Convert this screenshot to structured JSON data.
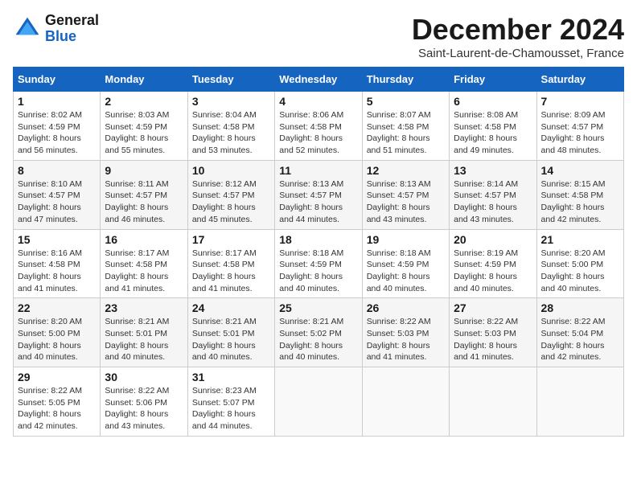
{
  "header": {
    "logo_line1": "General",
    "logo_line2": "Blue",
    "title": "December 2024",
    "subtitle": "Saint-Laurent-de-Chamousset, France"
  },
  "weekdays": [
    "Sunday",
    "Monday",
    "Tuesday",
    "Wednesday",
    "Thursday",
    "Friday",
    "Saturday"
  ],
  "weeks": [
    [
      {
        "day": "1",
        "sunrise": "8:02 AM",
        "sunset": "4:59 PM",
        "daylight": "8 hours and 56 minutes."
      },
      {
        "day": "2",
        "sunrise": "8:03 AM",
        "sunset": "4:59 PM",
        "daylight": "8 hours and 55 minutes."
      },
      {
        "day": "3",
        "sunrise": "8:04 AM",
        "sunset": "4:58 PM",
        "daylight": "8 hours and 53 minutes."
      },
      {
        "day": "4",
        "sunrise": "8:06 AM",
        "sunset": "4:58 PM",
        "daylight": "8 hours and 52 minutes."
      },
      {
        "day": "5",
        "sunrise": "8:07 AM",
        "sunset": "4:58 PM",
        "daylight": "8 hours and 51 minutes."
      },
      {
        "day": "6",
        "sunrise": "8:08 AM",
        "sunset": "4:58 PM",
        "daylight": "8 hours and 49 minutes."
      },
      {
        "day": "7",
        "sunrise": "8:09 AM",
        "sunset": "4:57 PM",
        "daylight": "8 hours and 48 minutes."
      }
    ],
    [
      {
        "day": "8",
        "sunrise": "8:10 AM",
        "sunset": "4:57 PM",
        "daylight": "8 hours and 47 minutes."
      },
      {
        "day": "9",
        "sunrise": "8:11 AM",
        "sunset": "4:57 PM",
        "daylight": "8 hours and 46 minutes."
      },
      {
        "day": "10",
        "sunrise": "8:12 AM",
        "sunset": "4:57 PM",
        "daylight": "8 hours and 45 minutes."
      },
      {
        "day": "11",
        "sunrise": "8:13 AM",
        "sunset": "4:57 PM",
        "daylight": "8 hours and 44 minutes."
      },
      {
        "day": "12",
        "sunrise": "8:13 AM",
        "sunset": "4:57 PM",
        "daylight": "8 hours and 43 minutes."
      },
      {
        "day": "13",
        "sunrise": "8:14 AM",
        "sunset": "4:57 PM",
        "daylight": "8 hours and 43 minutes."
      },
      {
        "day": "14",
        "sunrise": "8:15 AM",
        "sunset": "4:58 PM",
        "daylight": "8 hours and 42 minutes."
      }
    ],
    [
      {
        "day": "15",
        "sunrise": "8:16 AM",
        "sunset": "4:58 PM",
        "daylight": "8 hours and 41 minutes."
      },
      {
        "day": "16",
        "sunrise": "8:17 AM",
        "sunset": "4:58 PM",
        "daylight": "8 hours and 41 minutes."
      },
      {
        "day": "17",
        "sunrise": "8:17 AM",
        "sunset": "4:58 PM",
        "daylight": "8 hours and 41 minutes."
      },
      {
        "day": "18",
        "sunrise": "8:18 AM",
        "sunset": "4:59 PM",
        "daylight": "8 hours and 40 minutes."
      },
      {
        "day": "19",
        "sunrise": "8:18 AM",
        "sunset": "4:59 PM",
        "daylight": "8 hours and 40 minutes."
      },
      {
        "day": "20",
        "sunrise": "8:19 AM",
        "sunset": "4:59 PM",
        "daylight": "8 hours and 40 minutes."
      },
      {
        "day": "21",
        "sunrise": "8:20 AM",
        "sunset": "5:00 PM",
        "daylight": "8 hours and 40 minutes."
      }
    ],
    [
      {
        "day": "22",
        "sunrise": "8:20 AM",
        "sunset": "5:00 PM",
        "daylight": "8 hours and 40 minutes."
      },
      {
        "day": "23",
        "sunrise": "8:21 AM",
        "sunset": "5:01 PM",
        "daylight": "8 hours and 40 minutes."
      },
      {
        "day": "24",
        "sunrise": "8:21 AM",
        "sunset": "5:01 PM",
        "daylight": "8 hours and 40 minutes."
      },
      {
        "day": "25",
        "sunrise": "8:21 AM",
        "sunset": "5:02 PM",
        "daylight": "8 hours and 40 minutes."
      },
      {
        "day": "26",
        "sunrise": "8:22 AM",
        "sunset": "5:03 PM",
        "daylight": "8 hours and 41 minutes."
      },
      {
        "day": "27",
        "sunrise": "8:22 AM",
        "sunset": "5:03 PM",
        "daylight": "8 hours and 41 minutes."
      },
      {
        "day": "28",
        "sunrise": "8:22 AM",
        "sunset": "5:04 PM",
        "daylight": "8 hours and 42 minutes."
      }
    ],
    [
      {
        "day": "29",
        "sunrise": "8:22 AM",
        "sunset": "5:05 PM",
        "daylight": "8 hours and 42 minutes."
      },
      {
        "day": "30",
        "sunrise": "8:22 AM",
        "sunset": "5:06 PM",
        "daylight": "8 hours and 43 minutes."
      },
      {
        "day": "31",
        "sunrise": "8:23 AM",
        "sunset": "5:07 PM",
        "daylight": "8 hours and 44 minutes."
      },
      null,
      null,
      null,
      null
    ]
  ]
}
